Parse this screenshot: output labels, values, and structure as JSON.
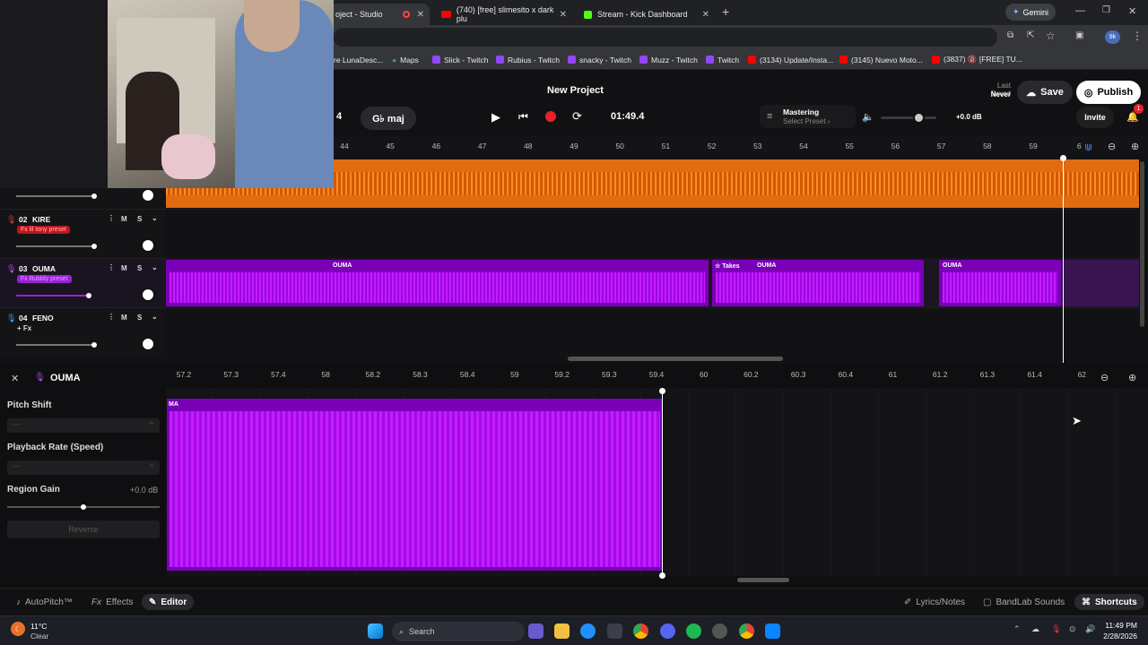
{
  "browser": {
    "tabs": [
      {
        "label": "oject - Studio",
        "active": true
      },
      {
        "label": "(740) [free] slimesito x dark plu",
        "active": false
      },
      {
        "label": "Stream - Kick Dashboard",
        "active": false
      }
    ],
    "new_tab": "+",
    "gemini_label": "Gemini",
    "profile_badge": "9k",
    "bookmarks": [
      "re LunaDesc...",
      "Maps",
      "Slick - Twitch",
      "Rubius - Twitch",
      "snacky - Twitch",
      "Muzz - Twitch",
      "Twitch",
      "(3134) Update/Insta...",
      "(3145) Nuevo Moto...",
      "(3837) 🔞 [FREE] TU..."
    ]
  },
  "studio": {
    "project_title": "New Project",
    "last_saved_label": "Last Saved",
    "last_saved_value": "Never",
    "save_label": "Save",
    "publish_label": "Publish",
    "invite_label": "Invite",
    "notif_count": "1",
    "bpm_partial": "4",
    "key_label": "G♭ maj",
    "time": "01:49.4",
    "mastering_label": "Mastering",
    "mastering_sub": "Select Preset ›",
    "master_volume": 0.68,
    "gain_label": "+0.0 dB"
  },
  "timeline": {
    "ticks": [
      "44",
      "45",
      "46",
      "47",
      "48",
      "49",
      "50",
      "51",
      "52",
      "53",
      "54",
      "55",
      "56",
      "57",
      "58",
      "59",
      "6"
    ]
  },
  "tracks": [
    {
      "num": "02",
      "name": "KIRE",
      "fx": "Fx lil tony preset",
      "fx_color": "#c0151c",
      "volume": 0.56
    },
    {
      "num": "03",
      "name": "OUMA",
      "fx": "Fx Bubbly preset",
      "fx_color": "#9b1fd6",
      "volume": 0.5
    },
    {
      "num": "04",
      "name": "FENO",
      "fx": "+ Fx",
      "fx_color": "transparent",
      "volume": 0.56
    }
  ],
  "regions": {
    "ouma_1": "OUMA",
    "takes": "Takes",
    "ouma_2": "OUMA",
    "ouma_3": "OUMA",
    "editor_region": "MA"
  },
  "editor": {
    "track_name": "OUMA",
    "ticks": [
      "57.2",
      "57.3",
      "57.4",
      "58",
      "58.2",
      "58.3",
      "58.4",
      "59",
      "59.2",
      "59.3",
      "59.4",
      "60",
      "60.2",
      "60.3",
      "60.4",
      "61",
      "61.2",
      "61.3",
      "61.4",
      "62"
    ],
    "pitch_shift": "Pitch Shift",
    "playback_rate": "Playback Rate (Speed)",
    "region_gain": "Region Gain",
    "region_gain_value": "+0.0 dB",
    "region_gain_level": 0.5,
    "reverse": "Reverse",
    "minus": "—",
    "plus": "+"
  },
  "bottom": {
    "autopitch": "AutoPitch™",
    "effects": "Effects",
    "editor": "Editor",
    "lyrics": "Lyrics/Notes",
    "sounds": "BandLab Sounds",
    "shortcuts": "Shortcuts"
  },
  "taskbar": {
    "temp": "11°C",
    "weather": "Clear",
    "search": "Search",
    "time": "11:49 PM",
    "date": "2/28/2026"
  }
}
